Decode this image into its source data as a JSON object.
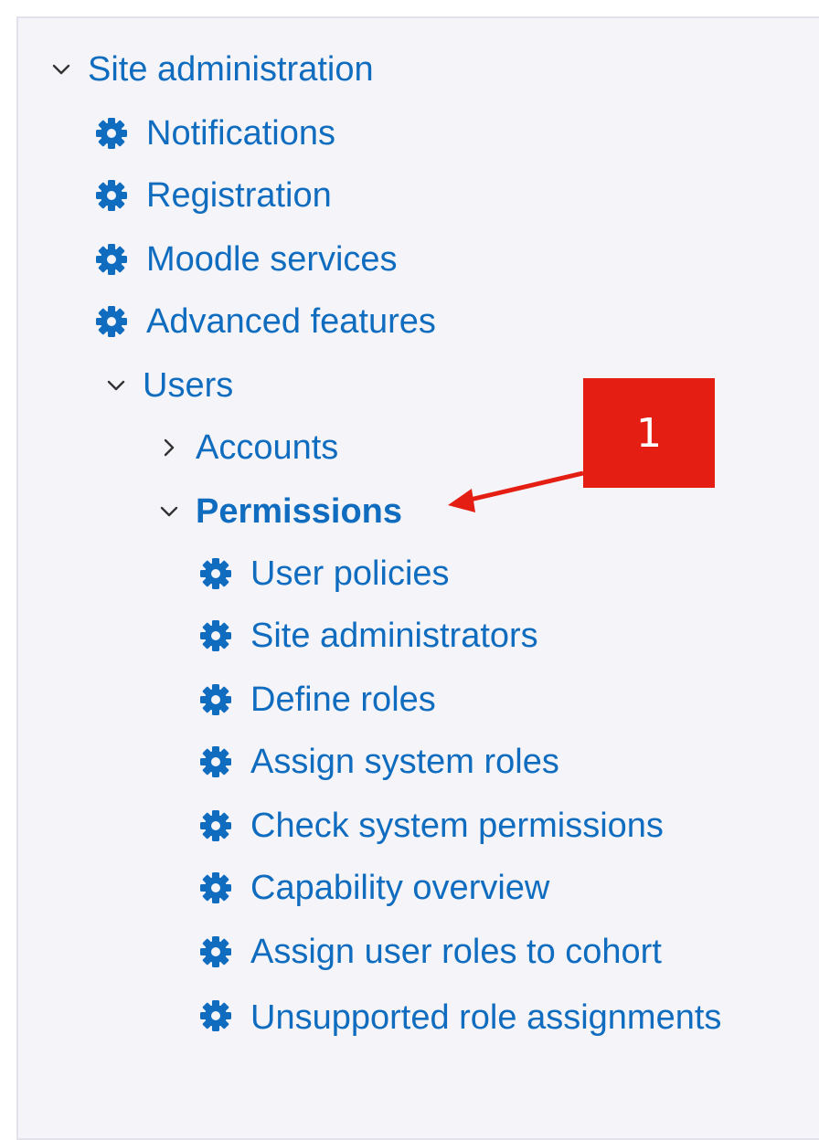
{
  "nav": {
    "site_admin": "Site administration",
    "items": [
      {
        "label": "Notifications"
      },
      {
        "label": "Registration"
      },
      {
        "label": "Moodle services"
      },
      {
        "label": "Advanced features"
      }
    ],
    "users": {
      "label": "Users",
      "accounts": "Accounts",
      "permissions": {
        "label": "Permissions",
        "items": [
          {
            "label": "User policies"
          },
          {
            "label": "Site administrators"
          },
          {
            "label": "Define roles"
          },
          {
            "label": "Assign system roles"
          },
          {
            "label": "Check system permissions"
          },
          {
            "label": "Capability overview"
          },
          {
            "label": "Assign user roles to cohort"
          },
          {
            "label": "Unsupported role assignments"
          }
        ]
      }
    }
  },
  "annotation": {
    "number": "1",
    "color": "#e41e12"
  },
  "colors": {
    "link": "#0f6cbf",
    "panel_bg": "#f4f4f9"
  }
}
